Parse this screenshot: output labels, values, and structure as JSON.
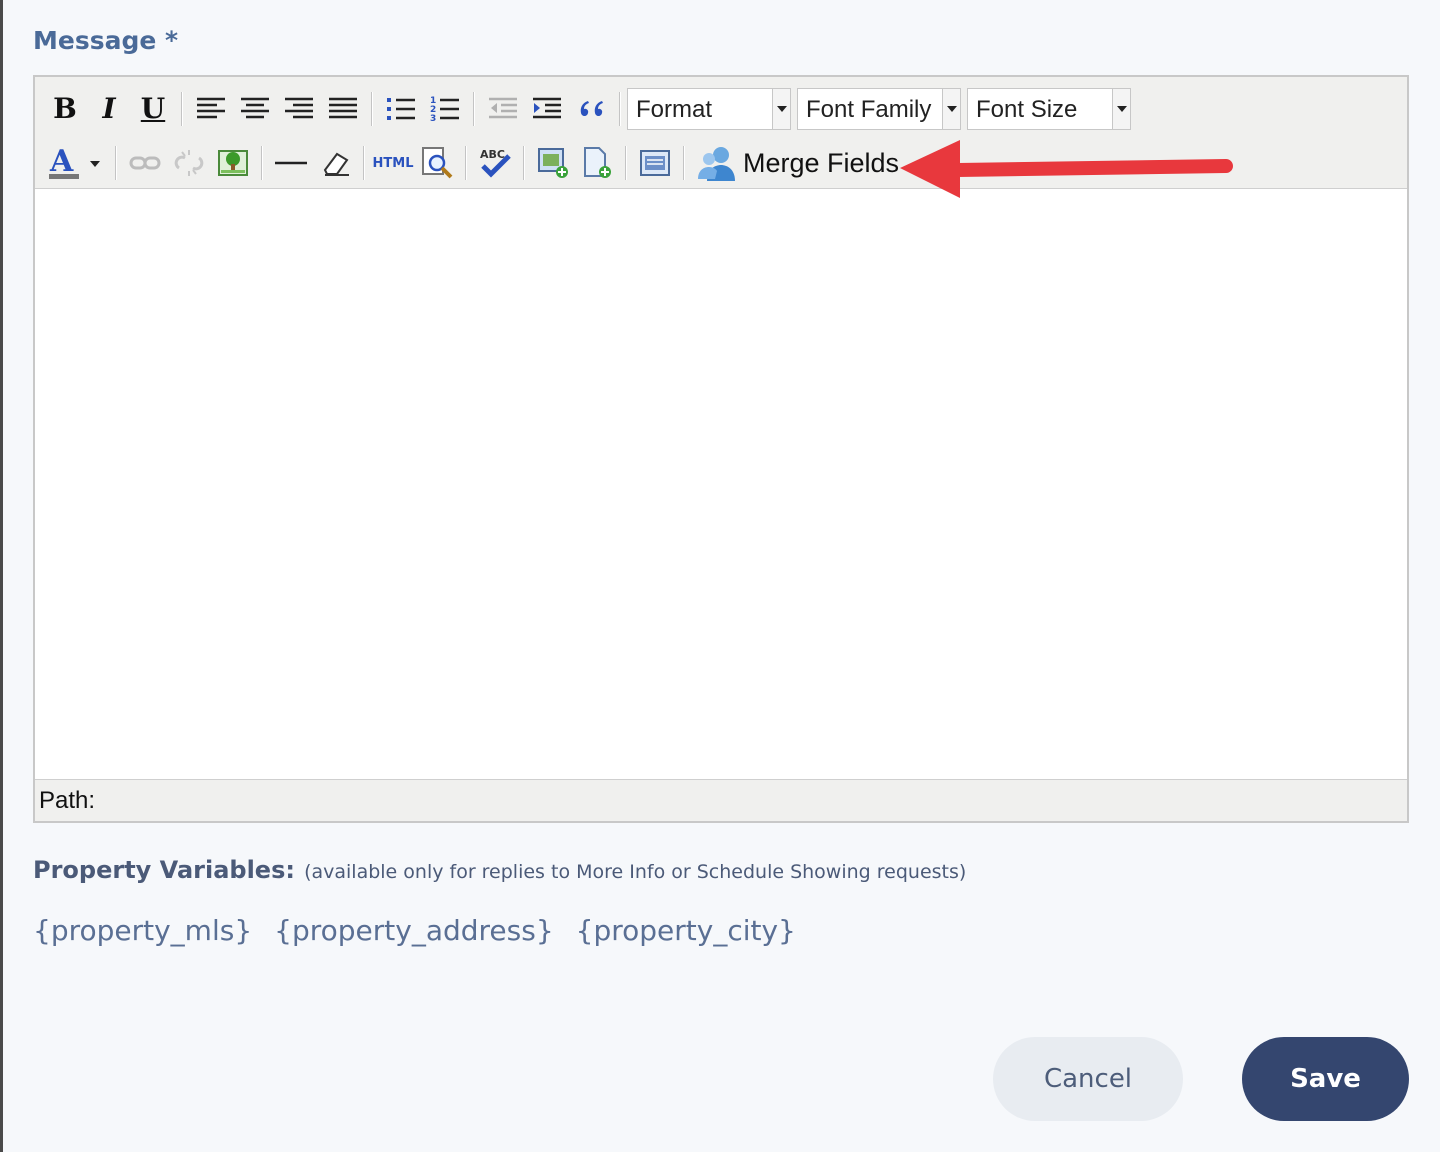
{
  "form": {
    "message_label": "Message *"
  },
  "toolbar": {
    "row1": {
      "bold": "B",
      "italic": "I",
      "underline": "U",
      "format_select": "Format",
      "font_family_select": "Font Family",
      "font_size_select": "Font Size"
    },
    "row2": {
      "html_label": "HTML",
      "spell_label": "ABC",
      "merge_fields": "Merge Fields"
    },
    "icons": [
      "bold-icon",
      "italic-icon",
      "underline-icon",
      "align-left-icon",
      "align-center-icon",
      "align-right-icon",
      "align-justify-icon",
      "bullet-list-icon",
      "numbered-list-icon",
      "outdent-icon",
      "indent-icon",
      "blockquote-icon",
      "text-color-icon",
      "link-icon",
      "unlink-icon",
      "image-icon",
      "horizontal-rule-icon",
      "eraser-icon",
      "html-source-icon",
      "preview-icon",
      "spellcheck-icon",
      "insert-image-icon",
      "insert-file-icon",
      "template-icon",
      "merge-fields-icon"
    ]
  },
  "editor": {
    "status_path": "Path:"
  },
  "variables": {
    "title": "Property Variables:",
    "note": "(available only for replies to More Info or Schedule Showing requests)",
    "tokens": [
      "{property_mls}",
      "{property_address}",
      "{property_city}"
    ]
  },
  "actions": {
    "cancel": "Cancel",
    "save": "Save"
  },
  "colors": {
    "primary": "#34466f",
    "label": "#4a6a98",
    "annotation_arrow": "#e8383d"
  }
}
